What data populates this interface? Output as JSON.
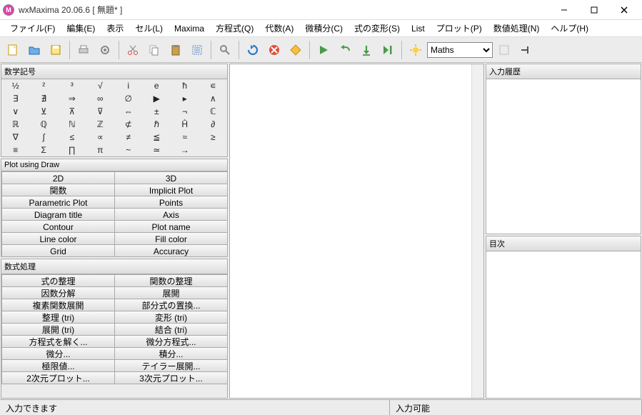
{
  "title": "wxMaxima 20.06.6 [ 無題* ]",
  "appicon_letter": "M",
  "menubar": [
    "ファイル(F)",
    "編集(E)",
    "表示",
    "セル(L)",
    "Maxima",
    "方程式(Q)",
    "代数(A)",
    "微積分(C)",
    "式の変形(S)",
    "List",
    "プロット(P)",
    "数値処理(N)",
    "ヘルプ(H)"
  ],
  "toolbar_select": "Maths",
  "panels": {
    "symbols_title": "数学記号",
    "plot_title": "Plot using Draw",
    "math_title": "数式処理",
    "history_title": "入力履歴",
    "toc_title": "目次"
  },
  "symbols": [
    "½",
    "²",
    "³",
    "√",
    "i",
    "e",
    "ħ",
    "∊",
    "∃",
    "∄",
    "⇒",
    "∞",
    "∅",
    "▶",
    "▸",
    "∧",
    "∨",
    "⊻",
    "⊼",
    "⊽",
    "⇔",
    "±",
    "¬",
    "ℂ",
    "ℝ",
    "ℚ",
    "ℕ",
    "ℤ",
    "⊄",
    "ℏ",
    "Ĥ",
    "∂",
    "∇",
    "∫",
    "≤",
    "∝",
    "≠",
    "≦",
    "≈",
    "≥",
    "≡",
    "Σ",
    "∏",
    "π",
    "~",
    "≃",
    "→"
  ],
  "plot_buttons": [
    [
      "2D",
      "3D"
    ],
    [
      "関数",
      "Implicit Plot"
    ],
    [
      "Parametric Plot",
      "Points"
    ],
    [
      "Diagram title",
      "Axis"
    ],
    [
      "Contour",
      "Plot name"
    ],
    [
      "Line color",
      "Fill color"
    ],
    [
      "Grid",
      "Accuracy"
    ]
  ],
  "math_buttons": [
    [
      "式の整理",
      "関数の整理"
    ],
    [
      "因数分解",
      "展開"
    ],
    [
      "複素関数展開",
      "部分式の置換..."
    ],
    [
      "整理 (tri)",
      "変形 (tri)"
    ],
    [
      "展開 (tri)",
      "結合 (tri)"
    ],
    [
      "方程式を解く...",
      "微分方程式..."
    ],
    [
      "微分...",
      "積分..."
    ],
    [
      "極限値...",
      "テイラー展開..."
    ],
    [
      "2次元プロット...",
      "3次元プロット..."
    ]
  ],
  "status": {
    "left": "入力できます",
    "right": "入力可能"
  }
}
